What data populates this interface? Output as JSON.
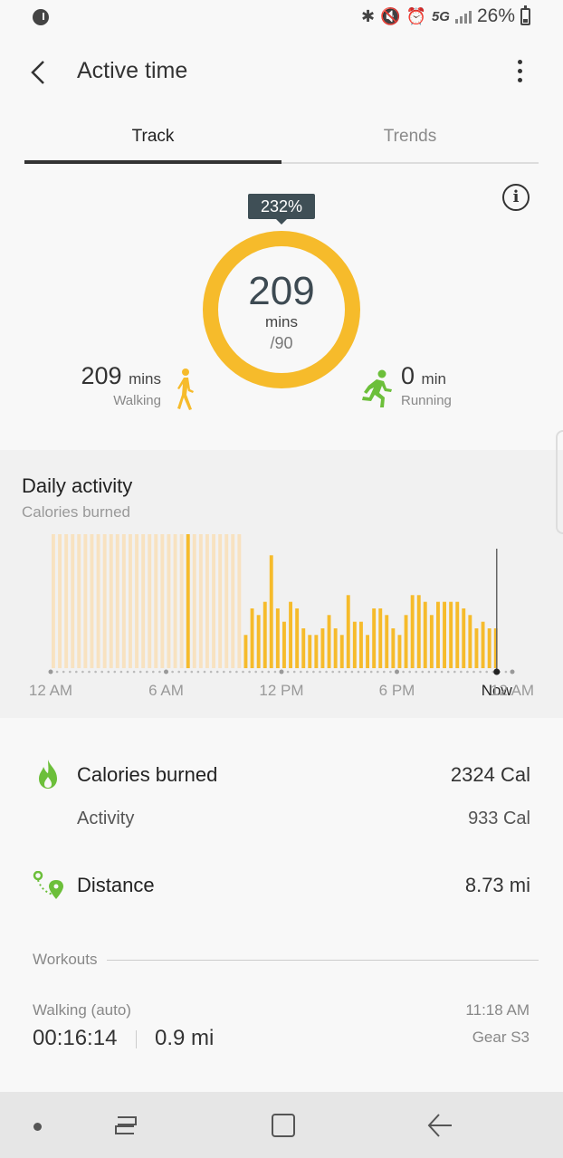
{
  "status_bar": {
    "network": "5G",
    "battery": "26%",
    "icons": [
      "music-icon",
      "bluetooth-icon",
      "mute-icon",
      "alarm-icon",
      "signal-icon",
      "battery-icon"
    ]
  },
  "header": {
    "title": "Active time",
    "back_icon": "back-arrow-icon",
    "menu_icon": "more-vertical-icon"
  },
  "tabs": [
    {
      "label": "Track",
      "active": true
    },
    {
      "label": "Trends",
      "active": false
    }
  ],
  "summary": {
    "percent": "232%",
    "total": "209",
    "unit": "mins",
    "goal": "/90",
    "progress_fraction": 1.0,
    "walking": {
      "value": "209",
      "unit": "mins",
      "label": "Walking"
    },
    "running": {
      "value": "0",
      "unit": "min",
      "label": "Running"
    }
  },
  "daily_activity": {
    "title": "Daily activity",
    "subtitle": "Calories burned",
    "axis_labels": [
      "12 AM",
      "6 AM",
      "12 PM",
      "6 PM",
      "Now",
      "12 AM"
    ]
  },
  "chart_data": {
    "type": "bar",
    "title": "Daily activity",
    "subtitle": "Calories burned",
    "x_ticks": [
      "12 AM",
      "6 AM",
      "12 PM",
      "6 PM",
      "Now",
      "12 AM"
    ],
    "bins_per_hour": 3,
    "now_index": 69,
    "values": [
      4,
      4,
      4,
      4,
      4,
      4,
      4,
      4,
      4,
      4,
      4,
      4,
      4,
      4,
      4,
      4,
      4,
      4,
      4,
      4,
      4,
      4,
      4,
      5,
      4,
      4,
      4,
      4,
      4,
      4,
      5,
      5,
      5,
      5,
      5,
      5,
      5,
      5,
      5,
      5,
      5,
      5,
      5,
      5,
      5,
      5,
      5,
      5,
      5,
      5,
      5,
      5,
      5,
      5,
      5,
      5,
      5,
      5,
      5,
      5,
      5,
      5,
      5,
      5,
      5,
      5,
      5,
      5,
      5,
      5
    ],
    "highlight_values": [
      0,
      0,
      0,
      0,
      0,
      0,
      0,
      0,
      0,
      0,
      0,
      0,
      0,
      0,
      0,
      0,
      0,
      0,
      0,
      0,
      0,
      5,
      0,
      0,
      0,
      0,
      0,
      0,
      0,
      0,
      0,
      0,
      0,
      0,
      0,
      0,
      0,
      0,
      0,
      0,
      0,
      0,
      0,
      0,
      0,
      0,
      0,
      0,
      0,
      0,
      0,
      0,
      0,
      0,
      0,
      0,
      0,
      0,
      0,
      0,
      0,
      0,
      0,
      0,
      0,
      0,
      0,
      0,
      0,
      0
    ],
    "active_values": [
      0,
      0,
      0,
      0,
      0,
      0,
      0,
      0,
      0,
      0,
      0,
      0,
      0,
      0,
      0,
      0,
      0,
      0,
      0,
      0,
      0,
      0,
      0,
      0,
      0,
      0,
      0,
      0,
      0,
      0,
      5,
      9,
      8,
      10,
      17,
      9,
      7,
      10,
      9,
      6,
      5,
      5,
      6,
      8,
      6,
      5,
      11,
      7,
      7,
      5,
      9,
      9,
      8,
      6,
      5,
      8,
      11,
      11,
      10,
      8,
      10,
      10,
      10,
      10,
      9,
      8,
      6,
      7,
      6,
      6
    ],
    "ylim": [
      0,
      18
    ]
  },
  "stats": {
    "calories": {
      "label": "Calories burned",
      "value": "2324 Cal",
      "icon": "flame-icon"
    },
    "activity": {
      "label": "Activity",
      "value": "933 Cal"
    },
    "distance": {
      "label": "Distance",
      "value": "8.73 mi",
      "icon": "route-icon"
    }
  },
  "workouts": {
    "section_label": "Workouts",
    "items": [
      {
        "type": "Walking (auto)",
        "time": "11:18 AM",
        "duration": "00:16:14",
        "distance": "0.9 mi",
        "device": "Gear S3"
      }
    ]
  },
  "colors": {
    "accent": "#f6bb2b",
    "accent_light": "#f8e2c0",
    "badge": "#3f4f56",
    "green": "#6cbf3a"
  }
}
